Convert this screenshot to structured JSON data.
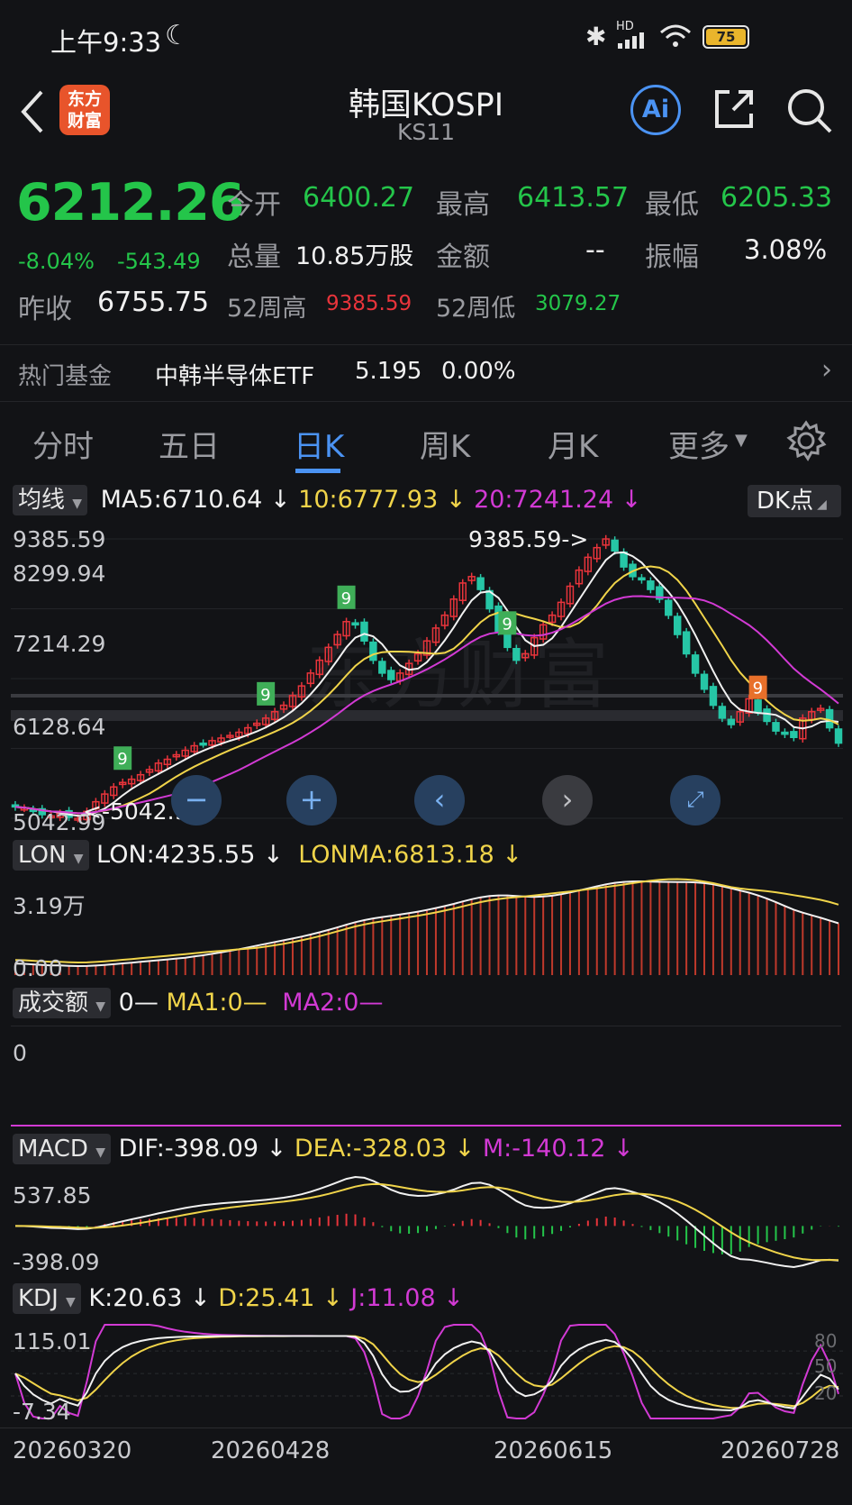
{
  "status": {
    "time": "上午9:33",
    "network": "HD",
    "battery": "75"
  },
  "header": {
    "title": "韩国KOSPI",
    "code": "KS11",
    "logo_top": "东方",
    "logo_bottom": "财富",
    "ai_label": "Ai"
  },
  "quote": {
    "price": "6212.26",
    "pct": "-8.04%",
    "chg": "-543.49",
    "open_label": "今开",
    "open": "6400.27",
    "high_label": "最高",
    "high": "6413.57",
    "low_label": "最低",
    "low": "6205.33",
    "vol_label": "总量",
    "vol": "10.85万股",
    "amount_label": "金额",
    "amount": "--",
    "amp_label": "振幅",
    "amp": "3.08%",
    "prev_label": "昨收",
    "prev": "6755.75",
    "w52h_label": "52周高",
    "w52h": "9385.59",
    "w52l_label": "52周低",
    "w52l": "3079.27"
  },
  "hotfund": {
    "label": "热门基金",
    "name": "中韩半导体ETF",
    "price": "5.195",
    "pct": "0.00%"
  },
  "tabs": [
    {
      "label": "分时"
    },
    {
      "label": "五日"
    },
    {
      "label": "日K"
    },
    {
      "label": "周K"
    },
    {
      "label": "月K"
    },
    {
      "label": "更多"
    }
  ],
  "kline": {
    "ma_dropdown": "均线",
    "ma5": "MA5:6710.64",
    "ma10": "10:6777.93",
    "ma20": "20:7241.24",
    "dk_button": "DK点",
    "y_labels": [
      "9385.59",
      "8299.94",
      "7214.29",
      "6128.64",
      "5042.99"
    ],
    "max_note": "9385.59->",
    "min_note": "<-5042.99",
    "watermark": "东方财富",
    "colors": {
      "up": "#e8343b",
      "down": "#26c6a6",
      "ma5": "#f1f1f1",
      "ma10": "#f0d44a",
      "ma20": "#d23ad4",
      "td": "#e8702a"
    }
  },
  "lon": {
    "dropdown": "LON",
    "lon": "LON:4235.55",
    "lonma": "LONMA:6813.18",
    "y_top": "3.19万",
    "y_bottom": "0.00"
  },
  "amount_ind": {
    "dropdown": "成交额",
    "zero": "0—",
    "ma1": "MA1:0—",
    "ma2": "MA2:0—",
    "y_label": "0"
  },
  "macd": {
    "dropdown": "MACD",
    "dif": "DIF:-398.09",
    "dea": "DEA:-328.03",
    "m": "M:-140.12",
    "y_top": "537.85",
    "y_bottom": "-398.09"
  },
  "kdj": {
    "dropdown": "KDJ",
    "k": "K:20.63",
    "d": "D:25.41",
    "j": "J:11.08",
    "y_top": "115.01",
    "y_bottom": "-7.34",
    "r80": "80",
    "r50": "50",
    "r20": "20"
  },
  "dates": [
    "20260320",
    "20260428",
    "20260615",
    "20260728"
  ],
  "chart_data": {
    "type": "candlestick",
    "title": "韩国KOSPI 日K",
    "y_ticks": [
      9385.59,
      8299.94,
      7214.29,
      6128.64,
      5042.99
    ],
    "ylim": [
      5042.99,
      9385.59
    ],
    "x_ticks": [
      "20260320",
      "20260428",
      "20260615",
      "20260728"
    ],
    "close_approx": [
      5220,
      5200,
      5150,
      5100,
      5080,
      5120,
      5060,
      5043,
      5150,
      5300,
      5420,
      5530,
      5600,
      5650,
      5720,
      5800,
      5900,
      5960,
      6030,
      6100,
      6170,
      6200,
      6250,
      6290,
      6330,
      6380,
      6450,
      6520,
      6600,
      6700,
      6800,
      6950,
      7100,
      7300,
      7500,
      7700,
      7900,
      8100,
      8050,
      7800,
      7500,
      7300,
      7200,
      7300,
      7450,
      7600,
      7800,
      8000,
      8200,
      8450,
      8700,
      8800,
      8600,
      8300,
      7950,
      7700,
      7500,
      7600,
      7850,
      8050,
      8200,
      8400,
      8650,
      8900,
      9100,
      9250,
      9385,
      9200,
      8950,
      8800,
      8750,
      8600,
      8450,
      8200,
      7900,
      7600,
      7300,
      7050,
      6800,
      6600,
      6500,
      6700,
      6900,
      6700,
      6550,
      6400,
      6350,
      6300,
      6600,
      6700,
      6750,
      6450,
      6212
    ],
    "series": [
      {
        "name": "MA5",
        "last": 6710.64
      },
      {
        "name": "MA10",
        "last": 6777.93
      },
      {
        "name": "MA20",
        "last": 7241.24
      }
    ]
  }
}
